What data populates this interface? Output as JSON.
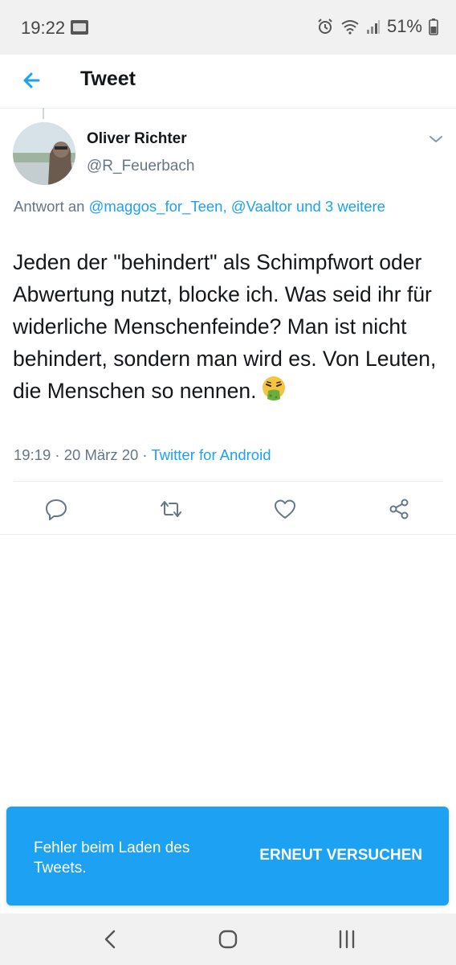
{
  "status_bar": {
    "time": "19:22",
    "battery": "51%"
  },
  "header": {
    "title": "Tweet"
  },
  "tweet": {
    "author_name": "Oliver Richter",
    "author_handle": "@R_Feuerbach",
    "reply_prefix": "Antwort an ",
    "reply_mentions": "@maggos_for_Teen, @Vaaltor und 3 weitere",
    "text": "Jeden der \"behindert\" als Schimpfwort oder Abwertung nutzt, blocke ich. Was seid ihr für widerliche Menschenfeinde? Man ist nicht behindert, sondern man wird es. Von Leuten, die Menschen so nennen.",
    "emoji": "face-vomiting",
    "timestamp": "19:19 · 20 März 20 · ",
    "source": "Twitter for Android"
  },
  "actions": [
    "reply-icon",
    "retweet-icon",
    "like-icon",
    "share-icon"
  ],
  "toast": {
    "message": "Fehler beim Laden des Tweets.",
    "action_label": "ERNEUT VERSUCHEN"
  },
  "colors": {
    "accent": "#1da1f2",
    "secondary_text": "#657786",
    "divider": "#e6ecf0"
  }
}
